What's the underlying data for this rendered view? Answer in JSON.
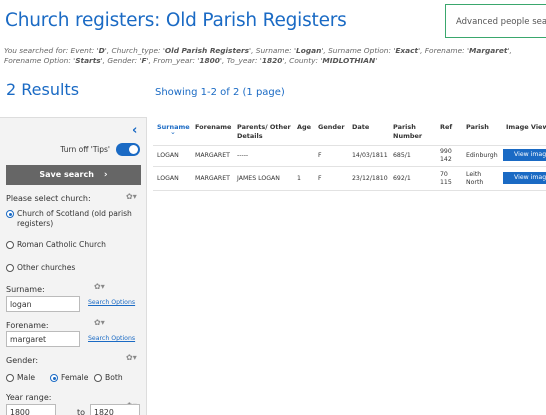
{
  "page": {
    "title": "Church registers: Old Parish Registers",
    "advanced_button": "Advanced people search",
    "summary": [
      {
        "text": "You searched for: Event: '",
        "bold": false
      },
      {
        "text": "D",
        "bold": true
      },
      {
        "text": "', Church_type: '",
        "bold": false
      },
      {
        "text": "Old Parish Registers",
        "bold": true
      },
      {
        "text": "', Surname: '",
        "bold": false
      },
      {
        "text": "Logan",
        "bold": true
      },
      {
        "text": "', Surname Option: '",
        "bold": false
      },
      {
        "text": "Exact",
        "bold": true
      },
      {
        "text": "', Forename: '",
        "bold": false
      },
      {
        "text": "Margaret",
        "bold": true
      },
      {
        "text": "', Forename Option: '",
        "bold": false
      },
      {
        "text": "Starts",
        "bold": true
      },
      {
        "text": "', Gender: '",
        "bold": false
      },
      {
        "text": "F",
        "bold": true
      },
      {
        "text": "', From_year: '",
        "bold": false
      },
      {
        "text": "1800",
        "bold": true
      },
      {
        "text": "', To_year: '",
        "bold": false
      },
      {
        "text": "1820",
        "bold": true
      },
      {
        "text": "', County: '",
        "bold": false
      },
      {
        "text": "MIDLOTHIAN",
        "bold": true
      },
      {
        "text": "'",
        "bold": false
      }
    ],
    "results_count": "2 Results",
    "showing": "Showing 1-2 of 2 (1 page)"
  },
  "sidebar": {
    "collapse_icon": "chevron-left-icon",
    "tips_label": "Turn off 'Tips'",
    "tips_on": true,
    "save_search": "Save search",
    "save_icon": "chevron-right-icon",
    "gear_icon": "gear-icon",
    "gear_glyph": "✿▾",
    "church_label": "Please select church:",
    "church_options": [
      {
        "label": "Church of Scotland (old parish registers)",
        "selected": true
      },
      {
        "label": "Roman Catholic Church",
        "selected": false
      },
      {
        "label": "Other churches",
        "selected": false
      }
    ],
    "surname_label": "Surname:",
    "surname_value": "logan",
    "forename_label": "Forename:",
    "forename_value": "margaret",
    "search_options": "Search Options",
    "gender_label": "Gender:",
    "gender_options": [
      {
        "label": "Male",
        "selected": false
      },
      {
        "label": "Female",
        "selected": true
      },
      {
        "label": "Both",
        "selected": false
      }
    ],
    "year_label": "Year range:",
    "year_from": "1800",
    "year_to_label": "to",
    "year_to": "1820"
  },
  "table": {
    "headers": [
      "Surname",
      "Forename",
      "Parents/ Other Details",
      "Age",
      "Gender",
      "Date",
      "Parish Number",
      "Ref",
      "Parish",
      "Image View"
    ],
    "sort_icon": "chevron-down-icon",
    "rows": [
      {
        "surname": "LOGAN",
        "forename": "MARGARET",
        "parents": "-----",
        "age": "",
        "gender": "F",
        "date": "14/03/1811",
        "parish_number": "685/1",
        "ref": "990 142",
        "parish": "Edinburgh",
        "image_view": "View image"
      },
      {
        "surname": "LOGAN",
        "forename": "MARGARET",
        "parents": "JAMES LOGAN",
        "age": "1",
        "gender": "F",
        "date": "23/12/1810",
        "parish_number": "692/1",
        "ref": "70 115",
        "parish": "Leith North",
        "image_view": "View image"
      }
    ]
  },
  "colors": {
    "accent": "#1a6ac4",
    "advanced_border": "#3aa76d",
    "save_button": "#666666",
    "sidebar_bg": "#f3f3f3"
  }
}
